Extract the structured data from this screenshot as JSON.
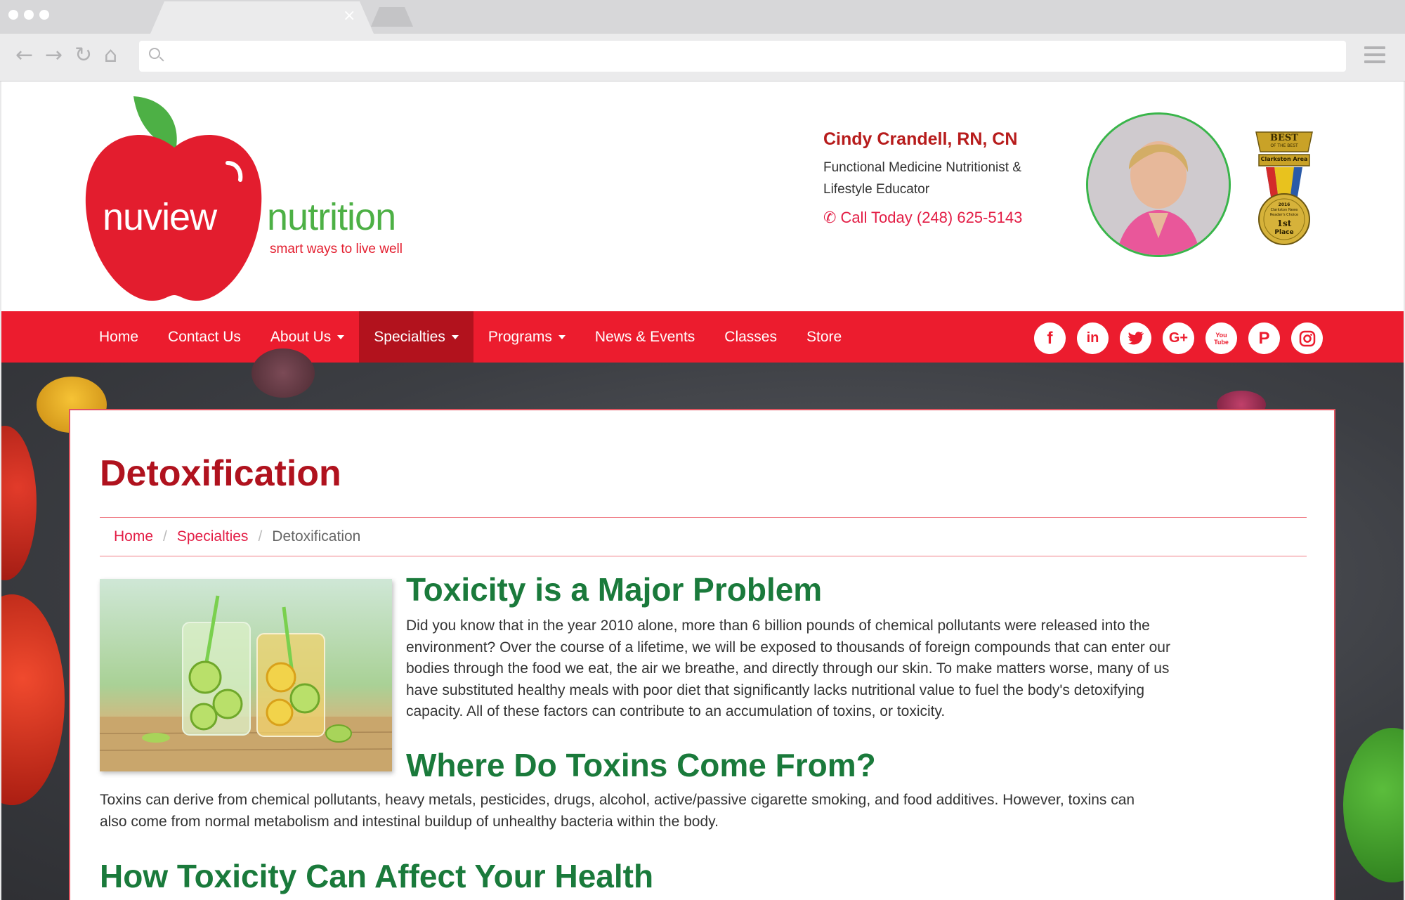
{
  "browser": {
    "tab_close_glyph": "×",
    "address_value": ""
  },
  "header": {
    "logo": {
      "word1": "nuview",
      "word2": "nutrition",
      "tagline": "smart ways to live well"
    },
    "contact": {
      "name": "Cindy Crandell, RN, CN",
      "title_line1": "Functional Medicine Nutritionist &",
      "title_line2": "Lifestyle Educator",
      "phone": "Call Today (248) 625-5143"
    },
    "award": {
      "top": "BEST",
      "subtop": "OF THE BEST",
      "ribbon": "Clarkston Area",
      "year": "2016",
      "medal_line1": "Clarkston News",
      "medal_line2": "Reader's Choice",
      "place": "1st",
      "place2": "Place"
    }
  },
  "nav": {
    "items": [
      {
        "label": "Home",
        "dropdown": false
      },
      {
        "label": "Contact Us",
        "dropdown": false
      },
      {
        "label": "About Us",
        "dropdown": true
      },
      {
        "label": "Specialties",
        "dropdown": true,
        "active": true
      },
      {
        "label": "Programs",
        "dropdown": true
      },
      {
        "label": "News & Events",
        "dropdown": false
      },
      {
        "label": "Classes",
        "dropdown": false
      },
      {
        "label": "Store",
        "dropdown": false
      }
    ],
    "socials": [
      {
        "icon": "facebook-icon",
        "glyph": "f"
      },
      {
        "icon": "linkedin-icon",
        "glyph": "in"
      },
      {
        "icon": "twitter-icon",
        "glyph": "t"
      },
      {
        "icon": "google-plus-icon",
        "glyph": "G+"
      },
      {
        "icon": "youtube-icon",
        "glyph": "You Tube"
      },
      {
        "icon": "pinterest-icon",
        "glyph": "P"
      },
      {
        "icon": "instagram-icon",
        "glyph": ""
      }
    ]
  },
  "content": {
    "title": "Detoxification",
    "breadcrumb": {
      "home": "Home",
      "section": "Specialties",
      "current": "Detoxification",
      "separator": "/"
    },
    "sections": [
      {
        "heading": "Toxicity is a Major Problem",
        "lines": [
          "Did you know that in the year 2010 alone, more than 6 billion pounds of chemical pollutants were released into the",
          "environment? Over the course of a lifetime, we will be exposed to thousands of foreign compounds that can enter our",
          "bodies through the food we eat, the air we breathe, and directly through our skin. To make matters worse, many of us",
          "have substituted healthy meals with poor diet that significantly lacks nutritional value to fuel the body's detoxifying",
          "capacity. All of these factors can contribute to an accumulation of toxins, or toxicity."
        ]
      },
      {
        "heading": "Where Do Toxins Come From?",
        "lines": [
          "Toxins can derive from chemical pollutants, heavy metals, pesticides, drugs, alcohol, active/passive cigarette smoking, and food additives. However, toxins can",
          "also come from normal metabolism and intestinal buildup of unhealthy bacteria within the body."
        ]
      },
      {
        "heading": "How Toxicity Can Affect Your Health",
        "lines": []
      }
    ]
  },
  "colors": {
    "brand_red": "#ec1c2e",
    "nav_active": "#b2121d",
    "heading_red": "#b0121e",
    "heading_green": "#1a7a3b",
    "logo_green": "#4db045",
    "link_pink": "#e31d45"
  }
}
